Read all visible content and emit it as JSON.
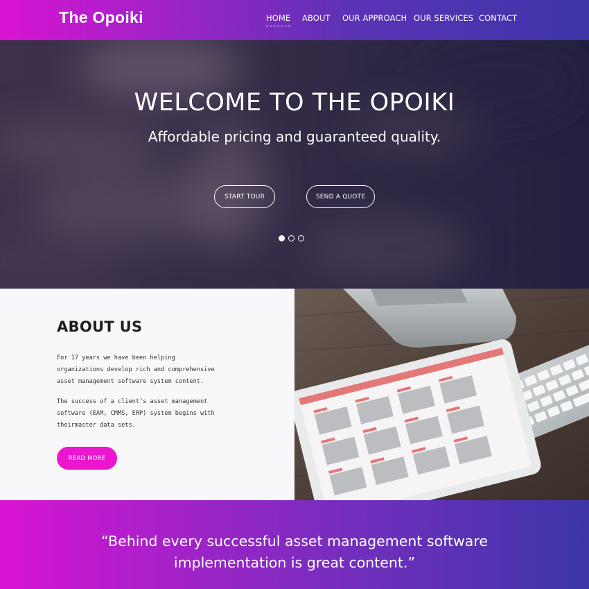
{
  "brand": "The Opoiki",
  "nav": {
    "items": [
      "HOME",
      "ABOUT",
      "OUR APPROACH",
      "OUR SERVICES",
      "CONTACT"
    ]
  },
  "hero": {
    "title": "WELCOME TO THE OPOIKI",
    "subtitle": "Affordable pricing and guaranteed quality.",
    "buttons": [
      "START TOUR",
      "SEND A QUOTE"
    ],
    "slides": 3,
    "active_slide": 1
  },
  "about": {
    "title": "ABOUT US",
    "paragraph1": "For 17 years we have been helping organizations develop rich and comprehensive asset management software system content.",
    "paragraph2": "The success of a client’s asset management software (EAM, CMMS, ERP) system begins with theirmaster data sets.",
    "button": "READ MORE"
  },
  "quote": {
    "text": "“Behind every successful asset management software implementation is great content.”"
  },
  "colors": {
    "gradient_start": "#d914d2",
    "gradient_end": "#3d34a8",
    "accent_button": "#ec16cf"
  }
}
